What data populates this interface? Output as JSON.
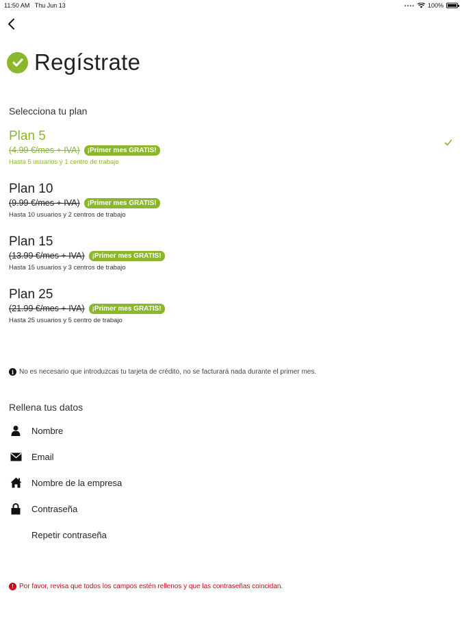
{
  "status_bar": {
    "time": "11:50 AM",
    "date": "Thu Jun 13",
    "battery": "100%"
  },
  "header": {
    "title": "Regístrate"
  },
  "plans_section": {
    "label": "Selecciona tu plan",
    "plans": [
      {
        "name": "Plan 5",
        "price": "(4.99 €/mes + IVA)",
        "badge": "¡Primer mes GRATIS!",
        "desc": "Hasta 5 usuarios y 1 centro de trabajo",
        "selected": true
      },
      {
        "name": "Plan 10",
        "price": "(9.99 €/mes + IVA)",
        "badge": "¡Primer mes GRATIS!",
        "desc": "Hasta 10 usuarios y 2 centros de trabajo",
        "selected": false
      },
      {
        "name": "Plan 15",
        "price": "(13.99 €/mes + IVA)",
        "badge": "¡Primer mes GRATIS!",
        "desc": "Hasta 15 usuarios y 3 centros de trabajo",
        "selected": false
      },
      {
        "name": "Plan 25",
        "price": "(21.99 €/mes + IVA)",
        "badge": "¡Primer mes GRATIS!",
        "desc": "Hasta 25 usuarios y 5 centro de trabajo",
        "selected": false
      }
    ]
  },
  "info_note": "No es necesario que introduzcas tu tarjeta de crédito, no se facturará nada durante el primer mes.",
  "form": {
    "label": "Rellena tus datos",
    "fields": [
      {
        "placeholder": "Nombre",
        "icon": "user-icon"
      },
      {
        "placeholder": "Email",
        "icon": "envelope-icon"
      },
      {
        "placeholder": "Nombre de la empresa",
        "icon": "home-icon"
      },
      {
        "placeholder": "Contraseña",
        "icon": "lock-icon"
      },
      {
        "placeholder": "Repetir contraseña",
        "icon": "none"
      }
    ]
  },
  "error_note": "Por favor, revisa que todos los campos estén rellenos y que las contraseñas coincidan.",
  "colors": {
    "accent": "#8ab72b",
    "error": "#d0021b",
    "text": "#222222"
  }
}
